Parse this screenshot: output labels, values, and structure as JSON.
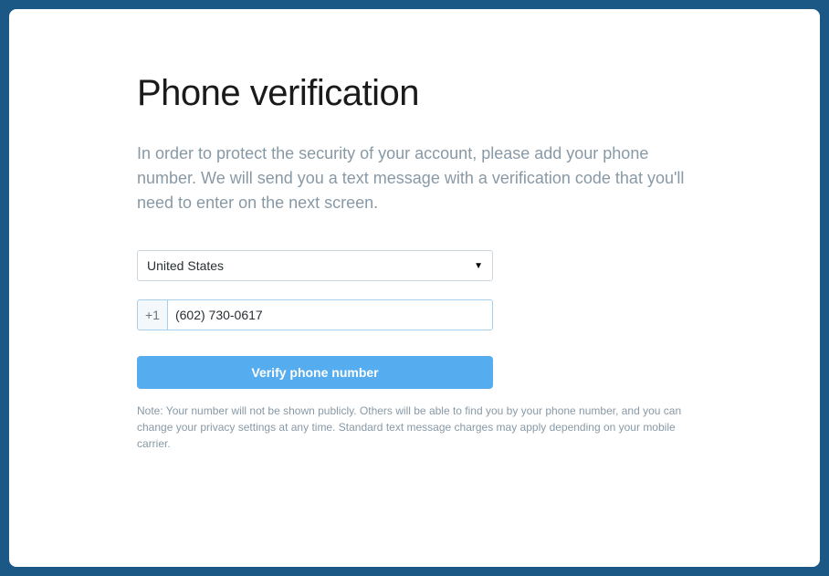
{
  "heading": "Phone verification",
  "description": "In order to protect the security of your account, please add your phone number. We will send you a text message with a verification code that you'll need to enter on the next screen.",
  "country": {
    "selected": "United States"
  },
  "phone": {
    "code": "+1",
    "value": "(602) 730-0617"
  },
  "verify_label": "Verify phone number",
  "note": "Note: Your number will not be shown publicly. Others will be able to find you by your phone number, and you can change your privacy settings at any time. Standard text message charges may apply depending on your mobile carrier."
}
